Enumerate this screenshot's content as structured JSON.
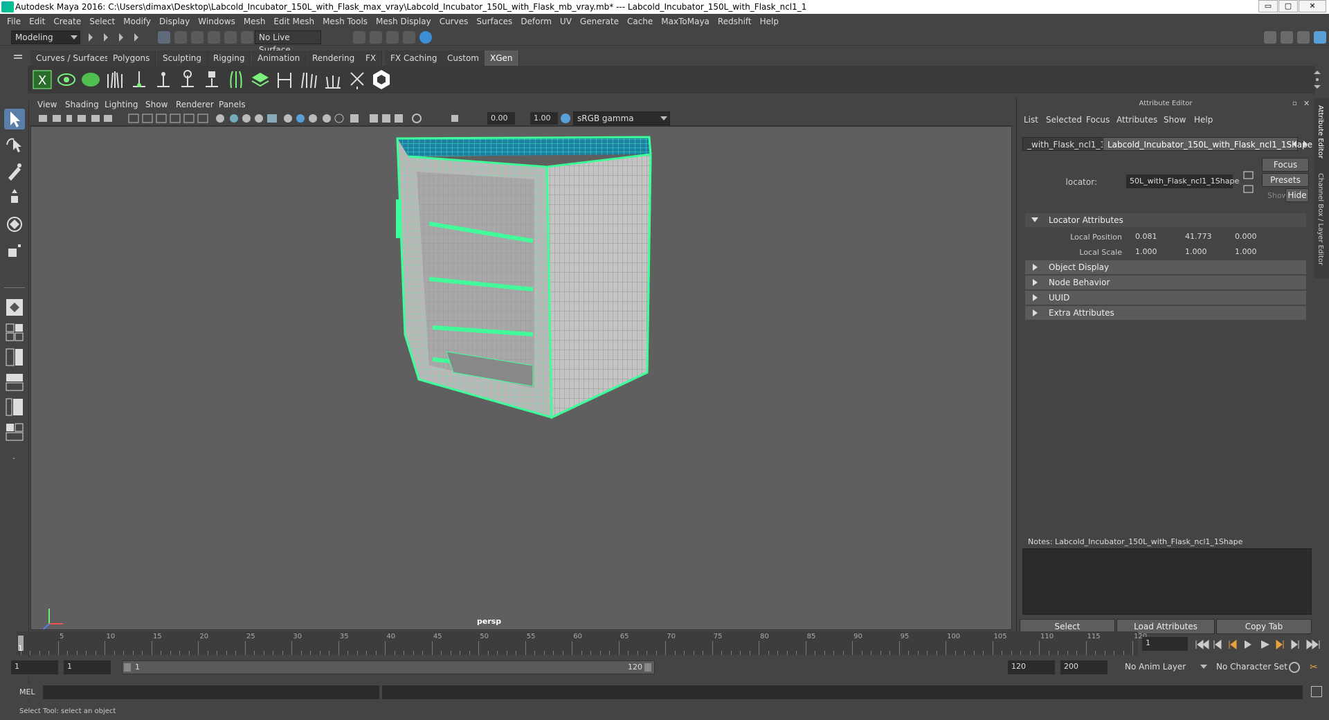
{
  "titlebar": {
    "title": "Autodesk Maya 2016: C:\\Users\\dimax\\Desktop\\Labcold_Incubator_150L_with_Flask_max_vray\\Labcold_Incubator_150L_with_Flask_mb_vray.mb*   ---   Labcold_Incubator_150L_with_Flask_ncl1_1",
    "minimize": "▭",
    "maximize": "▢",
    "close": "✕"
  },
  "menubar": [
    "File",
    "Edit",
    "Create",
    "Select",
    "Modify",
    "Display",
    "Windows",
    "Mesh",
    "Edit Mesh",
    "Mesh Tools",
    "Mesh Display",
    "Curves",
    "Surfaces",
    "Deform",
    "UV",
    "Generate",
    "Cache",
    "MaxToMaya",
    "Redshift",
    "Help"
  ],
  "statusline": {
    "mode": "Modeling",
    "live_surface": "No Live Surface"
  },
  "shelf_tabs": [
    "Curves / Surfaces",
    "Polygons",
    "Sculpting",
    "Rigging",
    "Animation",
    "Rendering",
    "FX",
    "FX Caching",
    "Custom",
    "XGen"
  ],
  "shelf_active": "XGen",
  "viewport": {
    "menus": [
      "View",
      "Shading",
      "Lighting",
      "Show",
      "Renderer",
      "Panels"
    ],
    "exposure": "0.00",
    "gamma": "1.00",
    "color_space": "sRGB gamma",
    "camera_label": "persp"
  },
  "attribute_editor": {
    "title": "Attribute Editor",
    "menus": [
      "List",
      "Selected",
      "Focus",
      "Attributes",
      "Show",
      "Help"
    ],
    "tabs": [
      "_with_Flask_ncl1_1",
      "Labcold_Incubator_150L_with_Flask_ncl1_1Shape"
    ],
    "locator_label": "locator:",
    "locator_value": "50L_with_Flask_ncl1_1Shape",
    "focus_btn": "Focus",
    "presets_btn": "Presets",
    "show_label": "Show",
    "hide_btn": "Hide",
    "sections": {
      "locator": "Locator Attributes",
      "object_display": "Object Display",
      "node_behavior": "Node Behavior",
      "uuid": "UUID",
      "extra": "Extra Attributes"
    },
    "local_position_label": "Local Position",
    "local_position": [
      "0.081",
      "41.773",
      "0.000"
    ],
    "local_scale_label": "Local Scale",
    "local_scale": [
      "1.000",
      "1.000",
      "1.000"
    ],
    "notes_label": "Notes:  Labcold_Incubator_150L_with_Flask_ncl1_1Shape",
    "select_btn": "Select",
    "load_btn": "Load Attributes",
    "copy_btn": "Copy Tab"
  },
  "side_tabs": [
    "Attribute Editor",
    "Channel Box / Layer Editor"
  ],
  "timeline": {
    "ticks": [
      "1",
      "5",
      "10",
      "15",
      "20",
      "25",
      "30",
      "35",
      "40",
      "45",
      "50",
      "55",
      "60",
      "65",
      "70",
      "75",
      "80",
      "85",
      "90",
      "95",
      "100",
      "105",
      "110",
      "115",
      "120"
    ],
    "current_frame": "1"
  },
  "range": {
    "start": "1",
    "playback_start": "1",
    "slider_start": "1",
    "slider_end": "120",
    "playback_end": "120",
    "end": "200",
    "anim_layer": "No Anim Layer",
    "char_set": "No Character Set"
  },
  "cmdline": {
    "label": "MEL"
  },
  "helpline": {
    "text": "Select Tool: select an object"
  },
  "colors": {
    "wire": "#3dff9a",
    "viewport_bg": "#5f5f5f",
    "panel": "#444444",
    "accent_blue": "#5aa0d8"
  }
}
